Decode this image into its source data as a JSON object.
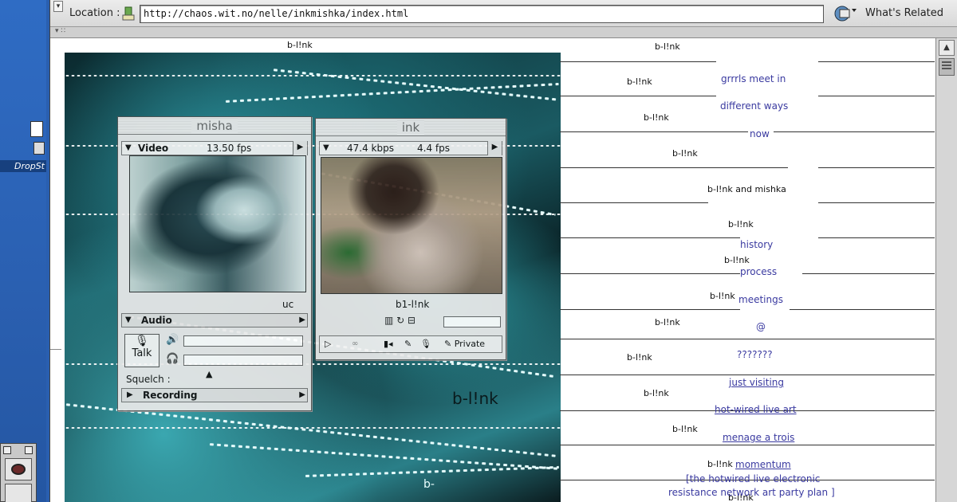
{
  "desktop": {
    "drive_label": "DropSt"
  },
  "browser": {
    "location_label": "Location :",
    "url": "http://chaos.wit.no/nelle/inkmishka/index.html",
    "whats_related": "What's Related"
  },
  "collage": {
    "top_label": "b-l!nk",
    "overlay_text": "b-l!nk",
    "bottom_text": "b-"
  },
  "misha": {
    "title": "misha",
    "video_label": "Video",
    "fps": "13.50 fps",
    "uc": "uc",
    "audio_label": "Audio",
    "talk_label": "Talk",
    "squelch_label": "Squelch :",
    "recording_label": "Recording"
  },
  "ink": {
    "title": "ink",
    "kbps": "47.4 kbps",
    "fps": "4.4 fps",
    "caption": "b1-l!nk",
    "private_label": "Private"
  },
  "right": {
    "blinks": [
      "b-l!nk",
      "b-l!nk",
      "b-l!nk",
      "b-l!nk",
      "b-l!nk and mishka",
      "b-l!nk",
      "b-l!nk",
      "b-l!nk",
      "b-l!nk",
      "b-l!nk",
      "b-l!nk",
      "b-l!nk",
      "b-l!nk",
      "b-l!nk"
    ],
    "links": [
      "grrrls meet in",
      "different ways",
      "now",
      "history",
      "process",
      "meetings",
      "@",
      "???????",
      "just visiting",
      "hot-wired live art",
      "menage a trois",
      "momentum"
    ],
    "footer": [
      "[the hotwired live electronic",
      "resistance network art party plan ]"
    ]
  },
  "colors": {
    "link": "#3a3aa0",
    "desktop": "#2a5fb0",
    "video_teal": "#2a8e99"
  }
}
